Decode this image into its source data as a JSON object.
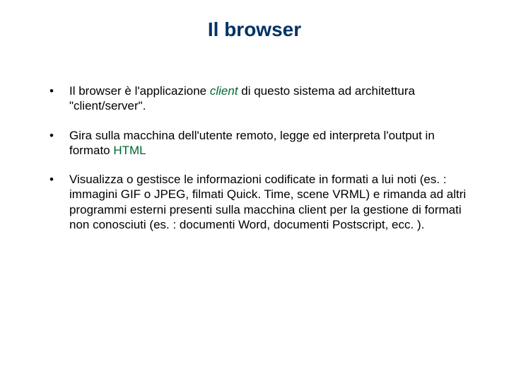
{
  "title": "Il browser",
  "bullets": {
    "b1": {
      "pre": "Il browser è l'applicazione ",
      "client": "client",
      "post": " di questo sistema ad architettura \"client/server\"."
    },
    "b2": {
      "pre": "Gira sulla macchina dell'utente remoto, legge ed interpreta l'output in formato ",
      "html": "HTML"
    },
    "b3": {
      "text": "Visualizza o gestisce le informazioni codificate in formati a lui noti (es. : immagini GIF o JPEG, filmati Quick. Time, scene VRML) e rimanda ad altri programmi esterni presenti sulla macchina client per la gestione di formati non conosciuti (es. : documenti Word, documenti Postscript, ecc. )."
    }
  }
}
